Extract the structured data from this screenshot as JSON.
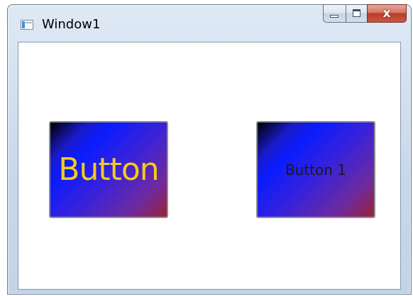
{
  "window": {
    "title": "Window1",
    "close_glyph": "x",
    "icons": {
      "app": "window-app-icon",
      "minimize": "minimize-icon",
      "maximize": "maximize-icon",
      "close": "close-icon"
    }
  },
  "buttons": [
    {
      "label": "Button",
      "text_color": "#f2cb1c"
    },
    {
      "label": "Button 1",
      "text_color": "#1a1a1a"
    }
  ],
  "colors": {
    "gradient_start": "#000000",
    "gradient_mid": "#0a1cff",
    "gradient_end": "#9a2238",
    "close_button": "#bd3b24"
  }
}
